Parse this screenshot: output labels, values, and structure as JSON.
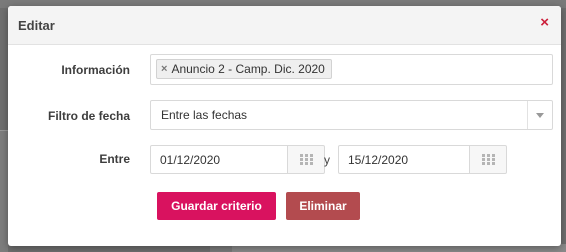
{
  "modal": {
    "title": "Editar",
    "close_label": "×"
  },
  "fields": {
    "informacion": {
      "label": "Información",
      "tags": [
        "Anuncio 2 - Camp. Dic. 2020"
      ],
      "tag_remove": "×"
    },
    "filtro": {
      "label": "Filtro de fecha",
      "selected": "Entre las fechas"
    },
    "entre": {
      "label": "Entre",
      "from": "01/12/2020",
      "separator": "y",
      "to": "15/12/2020"
    }
  },
  "actions": {
    "save_label": "Guardar criterio",
    "delete_label": "Eliminar"
  },
  "colors": {
    "save": "#d9125f",
    "delete": "#b34b4f",
    "close": "#cc1f3b"
  },
  "icons": {
    "close": "close-icon",
    "tag_remove": "tag-remove-icon",
    "select_arrow": "chevron-down-icon",
    "calendar": "calendar-grid-icon"
  }
}
